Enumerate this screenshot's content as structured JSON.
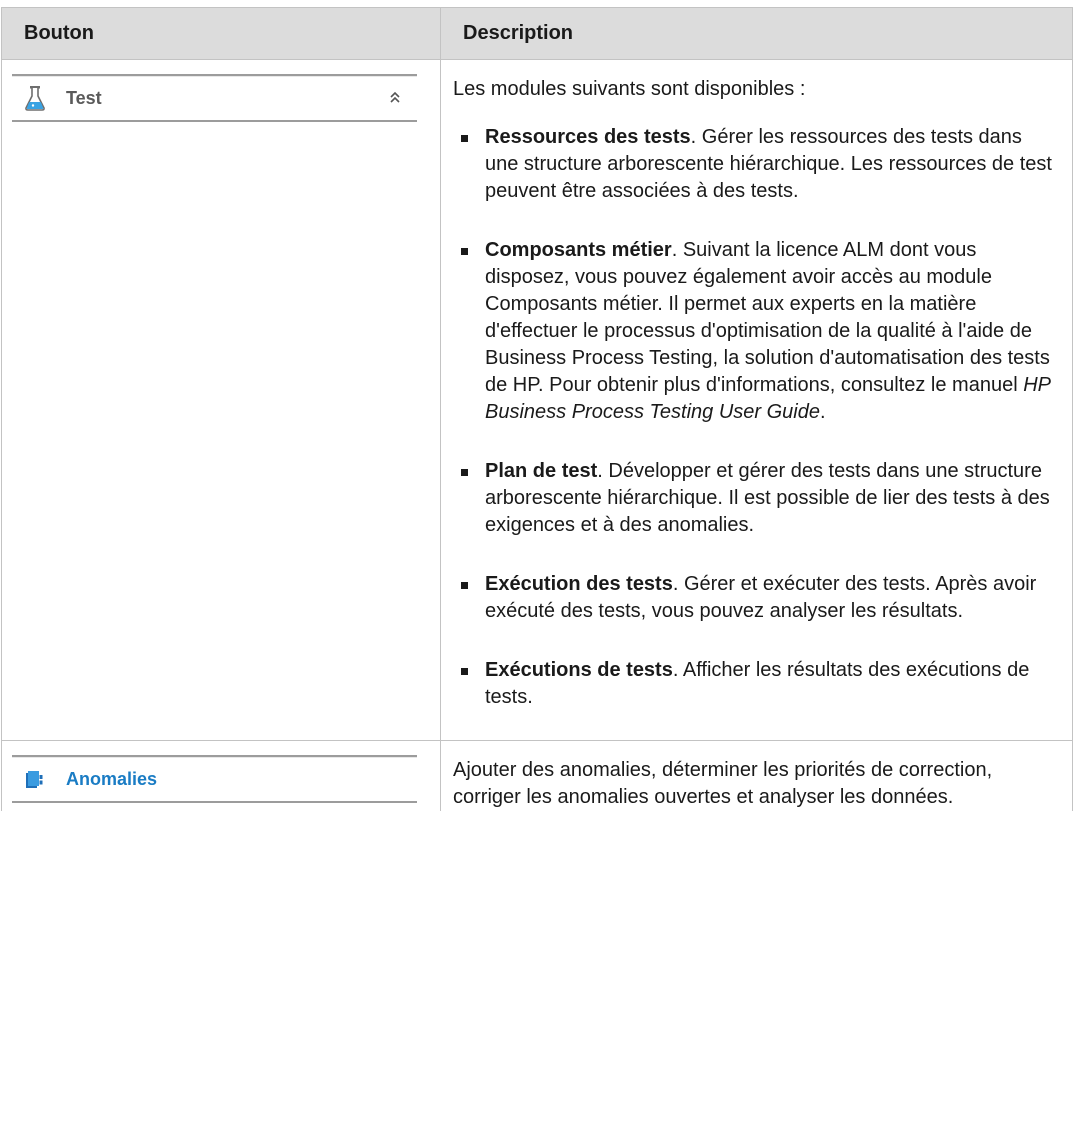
{
  "table": {
    "headers": {
      "col1": "Bouton",
      "col2": "Description"
    }
  },
  "row1": {
    "button": {
      "label": "Test",
      "icon": "flask-icon",
      "expander": "chevrons-up-icon"
    },
    "intro": "Les modules suivants sont disponibles :",
    "items": [
      {
        "term": "Ressources des tests",
        "text": ". Gérer les ressources des tests dans une structure arborescente hiérarchique. Les ressources de test peuvent être associées à des tests."
      },
      {
        "term": "Composants métier",
        "text": ". Suivant la licence ALM dont vous disposez, vous pouvez également avoir accès au module Composants métier. Il permet aux experts en la matière d'effectuer le processus d'optimisation de la qualité à l'aide de Business Process Testing, la solution d'automatisation des tests de HP. Pour obtenir plus d'informations, consultez le manuel ",
        "emphasis": "HP Business Process Testing User Guide",
        "tail": "."
      },
      {
        "term": "Plan de test",
        "text": ". Développer et gérer des tests dans une structure arborescente hiérarchique. Il est possible de lier des tests à des exigences et à des anomalies."
      },
      {
        "term": "Exécution des tests",
        "text": ". Gérer et exécuter des tests. Après avoir exécuté des tests, vous pouvez analyser les résultats."
      },
      {
        "term": "Exécutions de tests",
        "text": ". Afficher les résultats des exécutions de tests."
      }
    ]
  },
  "row2": {
    "button": {
      "label": "Anomalies",
      "icon": "defects-icon"
    },
    "description": "Ajouter des anomalies, déterminer les priorités de correction, corriger les anomalies ouvertes et analyser les données."
  },
  "colors": {
    "header_bg": "#dcdcdc",
    "border": "#c3c3c3",
    "link_blue": "#1a7cc4"
  }
}
